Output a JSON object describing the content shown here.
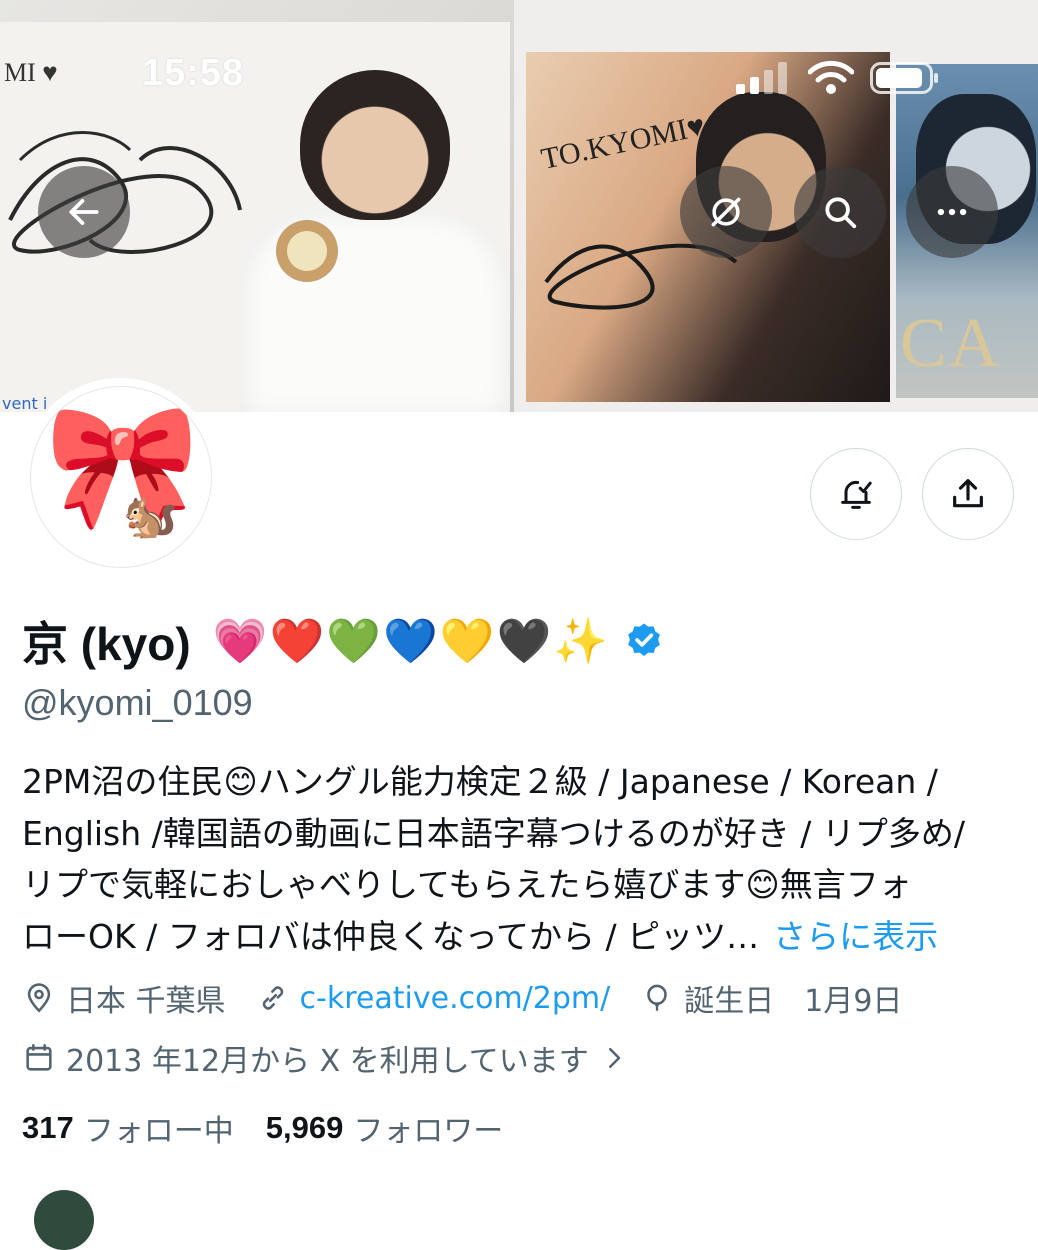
{
  "status_bar": {
    "time": "15:58"
  },
  "banner": {
    "photo1_text": "MI ♥",
    "photo1_caption": "vent i",
    "photo2_text": "TO.KYOMI♥",
    "photo3_text": "CA"
  },
  "header_buttons": {
    "back_icon": "arrow-left-icon",
    "sync_icon": "sync-off-icon",
    "search_icon": "search-icon",
    "more_icon": "more-horizontal-icon"
  },
  "profile": {
    "avatar_emoji": "🎀",
    "avatar_emoji2": "🐿️",
    "display_name": "京 (kyo)",
    "name_emojis": "💗❤️💚💙💛🖤✨",
    "handle": "@kyomi_0109",
    "verified_color": "#1d9bf0",
    "bio_lines": [
      "2PM沼の住民😊ハングル能力検定２級 / Japanese / Korean /",
      "English /韓国語の動画に日本語字幕つけるのが好き / リプ多め/",
      "リプで気軽におしゃべりしてもらえたら嬉びます😊無言フォ",
      "ローOK / フォロバは仲良くなってから / ピッツ…"
    ],
    "bio_more": "さらに表示",
    "location": "日本 千葉県",
    "website": "c-kreative.com/2pm/",
    "birthday_label": "誕生日",
    "birthday_value": "1月9日",
    "joined": "2013 年12月から X を利用しています",
    "following_count": "317",
    "following_label": "フォロー中",
    "followers_count": "5,969",
    "followers_label": "フォロワー"
  },
  "colors": {
    "link": "#1d9bf0",
    "secondary": "#536471",
    "primary": "#0f1419"
  }
}
